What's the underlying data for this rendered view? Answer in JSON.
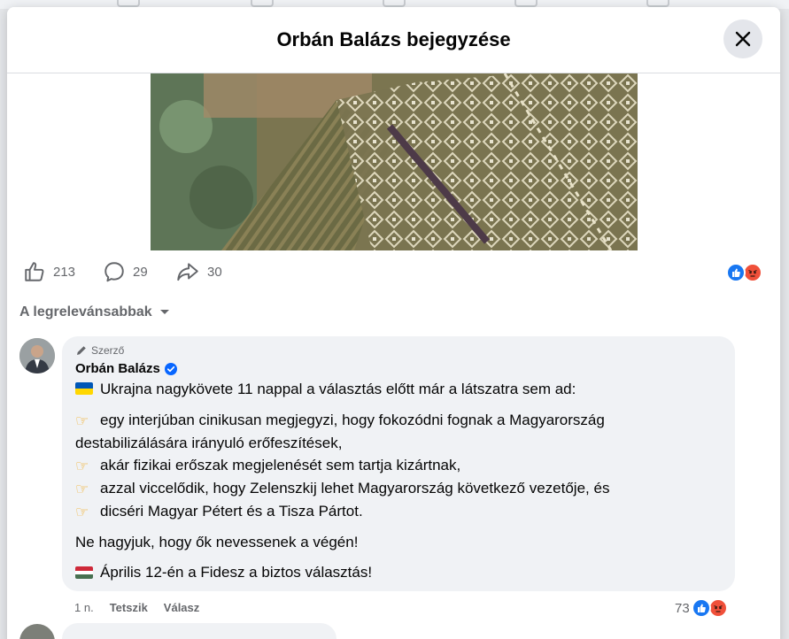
{
  "dialog": {
    "title": "Orbán Balázs bejegyzése",
    "close_icon": "close-icon"
  },
  "post": {
    "stats": {
      "likes": "213",
      "comments": "29",
      "shares": "30"
    },
    "reactions": [
      "like-reaction-icon",
      "angry-reaction-icon"
    ]
  },
  "comments_sort": {
    "label": "A legrelevánsabbak"
  },
  "comment": {
    "badge": "Szerző",
    "author": "Orbán Balázs",
    "verified_icon": "verified-badge-icon",
    "intro": "Ukrajna nagykövete 11 nappal a választás előtt már a látszatra sem ad:",
    "bullets": [
      "egy interjúban cinikusan megjegyzi, hogy fokozódni fognak a Magyarország",
      "destabilizálására irányuló erőfeszítések,",
      "akár fizikai erőszak megjelenését sem tartja kizártnak,",
      "azzal viccelődik, hogy Zelenszkij lehet Magyarország következő vezetője, és",
      "dicséri Magyar Pétert és a Tisza Pártot."
    ],
    "closing": "Ne hagyjuk, hogy ők nevessenek a végén!",
    "final": "Április 12-én a Fidesz a biztos választás!",
    "meta": {
      "time": "1 n.",
      "like": "Tetszik",
      "reply": "Válasz",
      "reaction_count": "73"
    }
  },
  "colors": {
    "like_blue": "#1877f2",
    "angry_orange": "#f0503a",
    "verified_blue": "#0866ff",
    "text_secondary": "#65676b"
  }
}
